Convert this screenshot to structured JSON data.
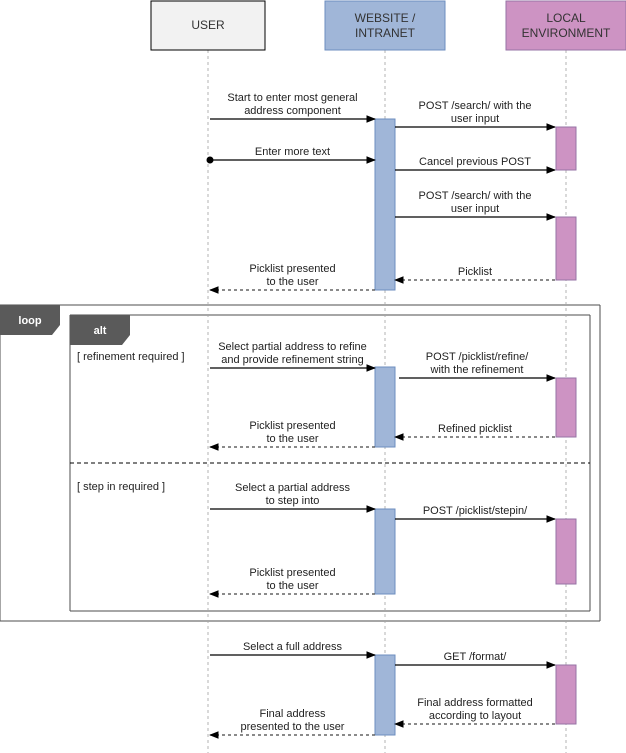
{
  "participants": [
    {
      "id": "user",
      "lines": [
        "USER"
      ],
      "fill": "#f2f2f2",
      "stroke": "#000000"
    },
    {
      "id": "website",
      "lines": [
        "WEBSITE /",
        "INTRANET"
      ],
      "fill": "#a0b6d8",
      "stroke": "#6c8ebf"
    },
    {
      "id": "local",
      "lines": [
        "LOCAL",
        "ENVIRONMENT"
      ],
      "fill": "#cd93c3",
      "stroke": "#9673a6"
    }
  ],
  "activations": [
    {
      "participant": "website",
      "label": "website-activation-1"
    },
    {
      "participant": "local",
      "label": "local-activation-1"
    },
    {
      "participant": "local",
      "label": "local-activation-2"
    },
    {
      "participant": "website",
      "label": "website-activation-2"
    },
    {
      "participant": "local",
      "label": "local-activation-3"
    },
    {
      "participant": "website",
      "label": "website-activation-3"
    },
    {
      "participant": "local",
      "label": "local-activation-4"
    },
    {
      "participant": "website",
      "label": "website-activation-4"
    },
    {
      "participant": "local",
      "label": "local-activation-5"
    }
  ],
  "messages": [
    {
      "from": "user",
      "to": "website",
      "type": "sync",
      "lines": [
        "Start to enter most general",
        "address component"
      ]
    },
    {
      "from": "website",
      "to": "local",
      "type": "sync",
      "lines": [
        "POST /search/ with the",
        "user input"
      ]
    },
    {
      "from": "user",
      "to": "website",
      "type": "sync-dot",
      "lines": [
        "Enter more text"
      ]
    },
    {
      "from": "website",
      "to": "local",
      "type": "sync",
      "lines": [
        "Cancel previous POST"
      ]
    },
    {
      "from": "website",
      "to": "local",
      "type": "sync",
      "lines": [
        "POST /search/ with the",
        "user input"
      ]
    },
    {
      "from": "local",
      "to": "website",
      "type": "reply",
      "lines": [
        "Picklist"
      ]
    },
    {
      "from": "website",
      "to": "user",
      "type": "reply",
      "lines": [
        "Picklist presented",
        "to the user"
      ]
    },
    {
      "from": "user",
      "to": "website",
      "type": "sync",
      "lines": [
        "Select partial address to refine",
        "and provide refinement string"
      ]
    },
    {
      "from": "website",
      "to": "local",
      "type": "sync",
      "lines": [
        "POST /picklist/refine/",
        "with the refinement"
      ]
    },
    {
      "from": "local",
      "to": "website",
      "type": "reply",
      "lines": [
        "Refined picklist"
      ]
    },
    {
      "from": "website",
      "to": "user",
      "type": "reply",
      "lines": [
        "Picklist presented",
        "to the user"
      ]
    },
    {
      "from": "user",
      "to": "website",
      "type": "sync",
      "lines": [
        "Select a partial address",
        "to step into"
      ]
    },
    {
      "from": "website",
      "to": "local",
      "type": "sync",
      "lines": [
        "POST /picklist/stepin/"
      ]
    },
    {
      "from": "website",
      "to": "user",
      "type": "reply",
      "lines": [
        "Picklist presented",
        "to the user"
      ]
    },
    {
      "from": "user",
      "to": "website",
      "type": "sync",
      "lines": [
        "Select a full address"
      ]
    },
    {
      "from": "website",
      "to": "local",
      "type": "sync",
      "lines": [
        "GET /format/"
      ]
    },
    {
      "from": "local",
      "to": "website",
      "type": "reply",
      "lines": [
        "Final address formatted",
        "according to layout"
      ]
    },
    {
      "from": "website",
      "to": "user",
      "type": "reply",
      "lines": [
        "Final address",
        "presented to the user"
      ]
    }
  ],
  "fragments": {
    "loop": {
      "tag": "loop"
    },
    "alt": {
      "tag": "alt",
      "guards": [
        "[ refinement required ]",
        "[ step in required ]"
      ]
    }
  },
  "colors": {
    "fragment_tag": "#5a5a5a",
    "fragment_border_top": "#a6a6a6",
    "fragment_border_side": "#4d4d4d",
    "lifeline": "#b3b3b3",
    "arrow": "#000000",
    "reply_arrow": "#444444"
  }
}
